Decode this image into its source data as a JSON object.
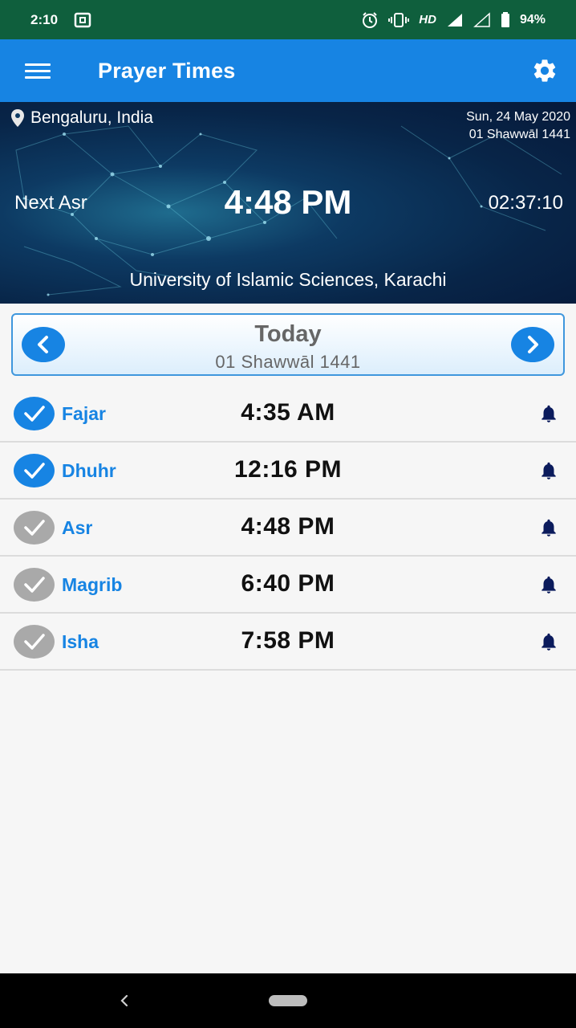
{
  "status_bar": {
    "time": "2:10",
    "hd_label": "HD",
    "battery": "94%"
  },
  "app_bar": {
    "title": "Prayer Times"
  },
  "hero": {
    "location": "Bengaluru, India",
    "gregorian_date": "Sun, 24 May 2020",
    "hijri_date": "01 Shawwāl 1441",
    "next_label": "Next Asr",
    "next_time": "4:48 PM",
    "countdown": "02:37:10",
    "calculation_method": "University of Islamic Sciences, Karachi"
  },
  "date_nav": {
    "title": "Today",
    "subtitle": "01 Shawwāl 1441"
  },
  "prayers": [
    {
      "name": "Fajar",
      "time": "4:35 AM",
      "completed": true
    },
    {
      "name": "Dhuhr",
      "time": "12:16 PM",
      "completed": true
    },
    {
      "name": "Asr",
      "time": "4:48 PM",
      "completed": false
    },
    {
      "name": "Magrib",
      "time": "6:40 PM",
      "completed": false
    },
    {
      "name": "Isha",
      "time": "7:58 PM",
      "completed": false
    }
  ],
  "colors": {
    "status_bar": "#0f5f3d",
    "accent": "#1784e3",
    "check_done": "#1784e3",
    "check_pending": "#a9a9a9",
    "bell": "#0b1b5c"
  },
  "icons": {
    "menu": "hamburger-icon",
    "settings": "gear-icon",
    "location": "location-pin-icon",
    "prev": "chevron-left-icon",
    "next": "chevron-right-icon",
    "check": "checkmark-icon",
    "bell": "bell-icon"
  }
}
